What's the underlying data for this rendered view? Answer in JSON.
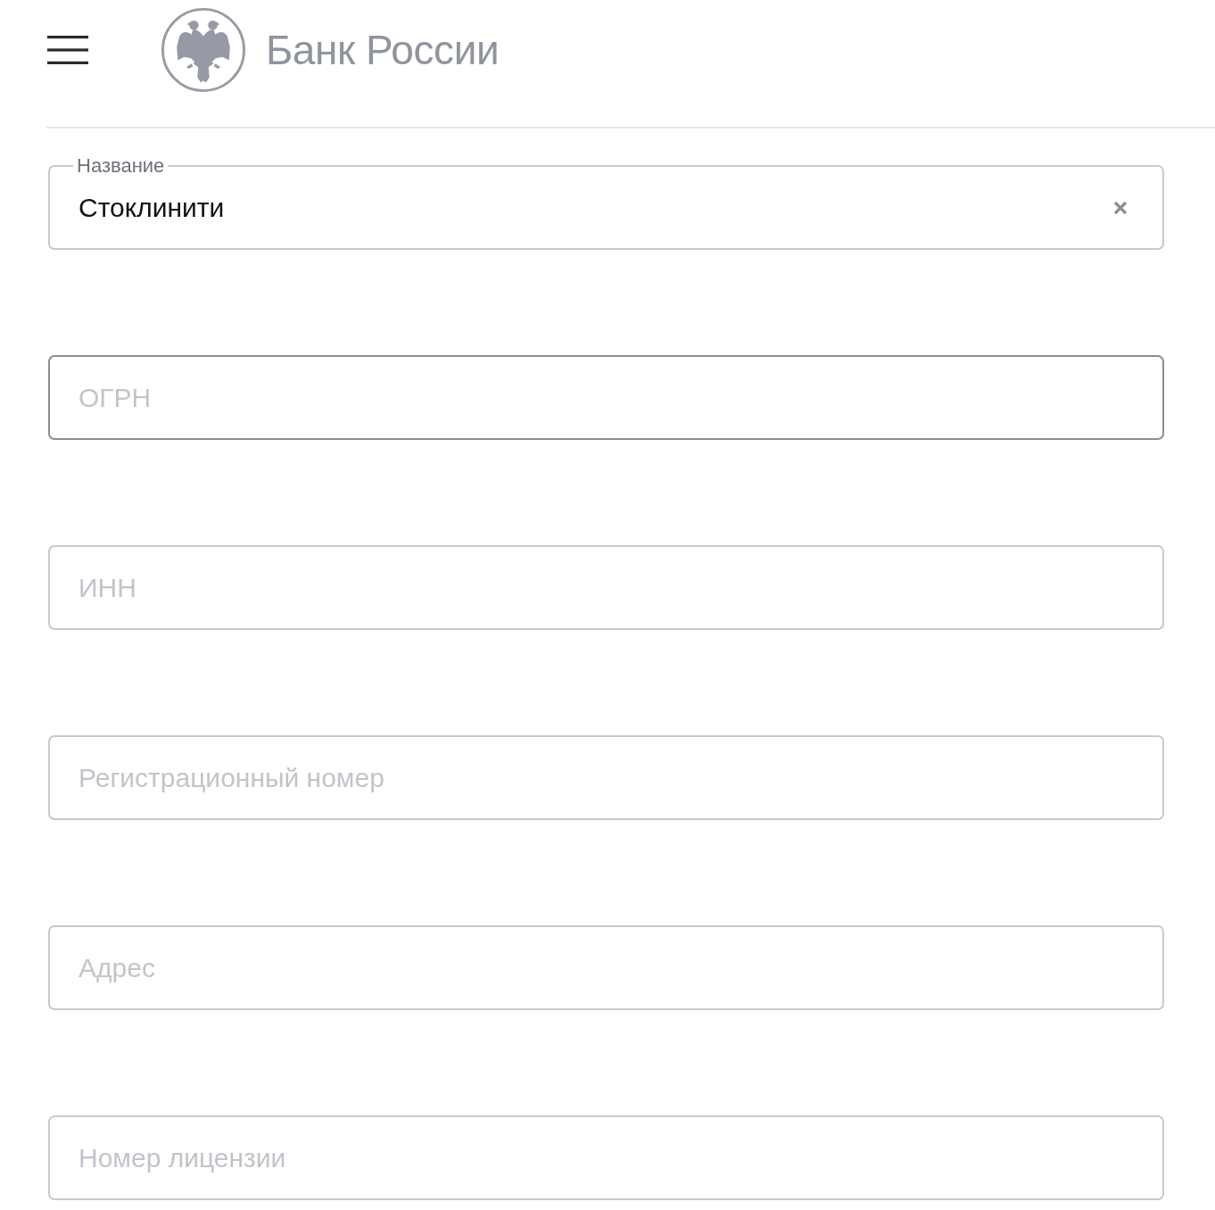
{
  "header": {
    "title": "Банк России"
  },
  "fields": [
    {
      "kind": "filled",
      "label": "Название",
      "value": "Стоклинити",
      "focused": false
    },
    {
      "kind": "empty",
      "placeholder": "ОГРН",
      "focused": true
    },
    {
      "kind": "empty",
      "placeholder": "ИНН",
      "focused": false
    },
    {
      "kind": "empty",
      "placeholder": "Регистрационный номер",
      "focused": false
    },
    {
      "kind": "empty",
      "placeholder": "Адрес",
      "focused": false
    },
    {
      "kind": "empty",
      "placeholder": "Номер лицензии",
      "focused": false
    }
  ]
}
